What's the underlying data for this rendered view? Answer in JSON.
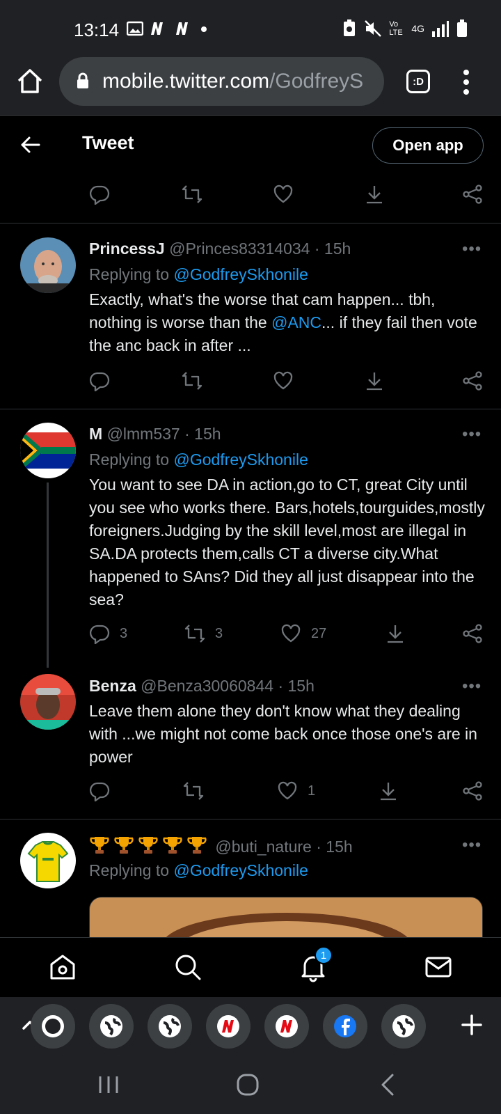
{
  "status": {
    "time": "13:14",
    "volte": "Vo LTE",
    "network": "4G"
  },
  "browser": {
    "url_host": "mobile.twitter.com",
    "url_path": "/GodfreyS",
    "tabs_label": ":D"
  },
  "header": {
    "title": "Tweet",
    "open_app": "Open app"
  },
  "tweets": [
    {
      "name": "PrincessJ",
      "handle": "@Princes83314034",
      "time": "· 15h",
      "replying_prefix": "Replying to ",
      "replying_to": "@GodfreySkhonile",
      "body_1": "Exactly,  what's the worse that cam happen... tbh, nothing is worse than the ",
      "body_mention": "@ANC",
      "body_2": "... if they fail then vote the anc back in after ...",
      "replies": "",
      "retweets": "",
      "likes": ""
    },
    {
      "name": "M",
      "handle": "@lmm537",
      "time": "· 15h",
      "replying_prefix": "Replying to ",
      "replying_to": "@GodfreySkhonile",
      "body": "You want to see DA in action,go to CT, great City until you see who works there. Bars,hotels,tourguides,mostly foreigners.Judging by the skill level,most are illegal in SA.DA protects them,calls CT a diverse city.What happened to SAns? Did they all just disappear into the sea?",
      "replies": "3",
      "retweets": "3",
      "likes": "27"
    },
    {
      "name": "Benza",
      "handle": "@Benza30060844",
      "time": "· 15h",
      "body": "Leave them alone they don't know what they dealing with ...we might not come back once those one's are in power",
      "replies": "",
      "retweets": "",
      "likes": "1"
    },
    {
      "name_emoji": "trophy",
      "handle": "@buti_nature",
      "time": "· 15h",
      "replying_prefix": "Replying to ",
      "replying_to": "@GodfreySkhonile"
    }
  ],
  "more_label": "•••",
  "nav": {
    "notifications_badge": "1"
  },
  "colors": {
    "accent": "#1d9bf0",
    "background": "#000000",
    "chrome": "#202124"
  }
}
